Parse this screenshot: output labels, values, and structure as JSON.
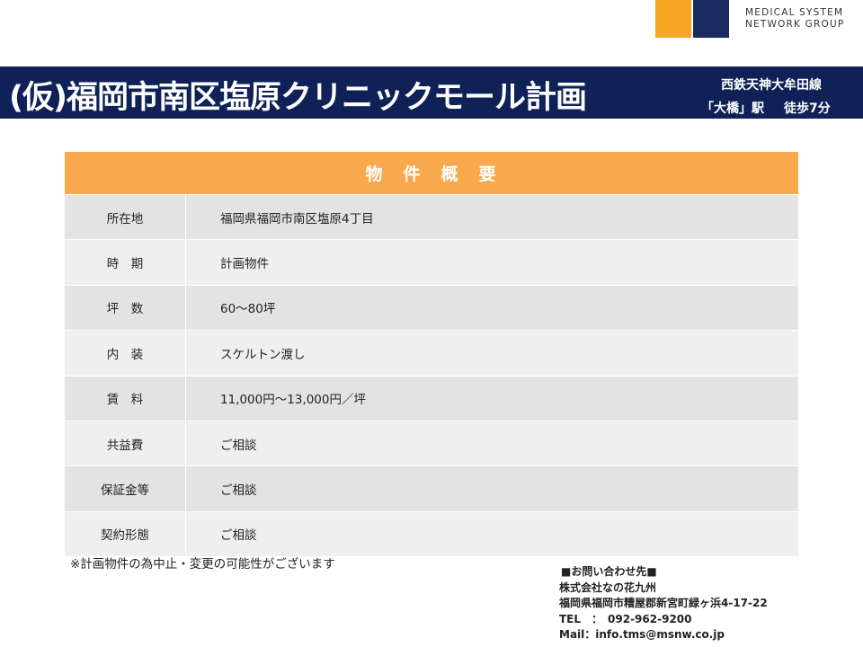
{
  "logo": {
    "line1": "MEDICAL SYSTEM",
    "line2": "NETWORK GROUP",
    "colors": [
      "#f5a623",
      "#1a2a5e"
    ]
  },
  "header": {
    "title": "(仮)福岡市南区塩原クリニックモール計画",
    "station_line": "西鉄天神大牟田線",
    "station_name": "「大橋」駅",
    "walk": "徒歩7分",
    "bar_color": "#0f2157"
  },
  "table": {
    "heading": "物　件　概　要",
    "heading_color": "#f8a94d",
    "rows": [
      {
        "label": "所在地",
        "value": "福岡県福岡市南区塩原4丁目"
      },
      {
        "label": "時　期",
        "value": "計画物件"
      },
      {
        "label": "坪　数",
        "value": "60～80坪"
      },
      {
        "label": "内　装",
        "value": "スケルトン渡し"
      },
      {
        "label": "賃　料",
        "value": "11,000円～13,000円／坪"
      },
      {
        "label": "共益費",
        "value": "ご相談"
      },
      {
        "label": "保証金等",
        "value": "ご相談"
      },
      {
        "label": "契約形態",
        "value": "ご相談"
      }
    ]
  },
  "note": "※計画物件の為中止・変更の可能性がございます",
  "contact": {
    "heading": "■お問い合わせ先■",
    "company": "株式会社なの花九州",
    "address": "福岡県福岡市糟屋郡新宮町緑ヶ浜4-17-22",
    "tel": "TEL　：　092-962-9200",
    "mail": "Mail：info.tms@msnw.co.jp"
  }
}
